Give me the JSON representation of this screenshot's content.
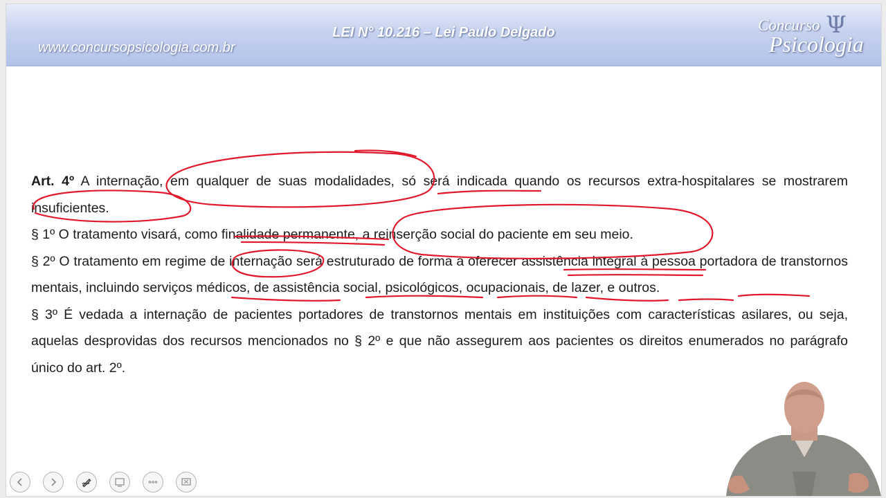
{
  "header": {
    "site_url": "www.concursopsicologia.com.br",
    "title": "LEI N° 10.216 – Lei Paulo Delgado",
    "logo_top": "Concurso",
    "logo_bottom": "Psicologia",
    "logo_symbol": "Ψ"
  },
  "body": {
    "art4_label": "Art. 4º",
    "art4_text": "A internação, em qualquer de suas modalidades, só será indicada quando os recursos extra-hospitalares se mostrarem insuficientes.",
    "par1": "§ 1º O tratamento visará, como finalidade permanente, a reinserção social do paciente em seu meio.",
    "par2": "§ 2º O tratamento em regime de internação será estruturado de forma a oferecer assistência integral à pessoa portadora de transtornos mentais, incluindo serviços médicos, de assistência social, psicológicos, ocupacionais, de lazer, e outros.",
    "par3": "§ 3º É vedada a internação de pacientes portadores de transtornos mentais em instituições com características asilares, ou seja, aquelas desprovidas dos recursos mencionados no § 2º e que não assegurem aos pacientes os direitos enumerados no parágrafo único do art. 2º."
  },
  "toolbar": {
    "buttons": [
      {
        "icon": "arrow-left-icon"
      },
      {
        "icon": "arrow-right-icon"
      },
      {
        "icon": "pen-icon"
      },
      {
        "icon": "slide-view-icon"
      },
      {
        "icon": "more-icon"
      },
      {
        "icon": "screen-icon"
      }
    ]
  },
  "colors": {
    "annotation": "#e0182b",
    "header": "#c6d2ef",
    "text": "#1c1c1c"
  }
}
